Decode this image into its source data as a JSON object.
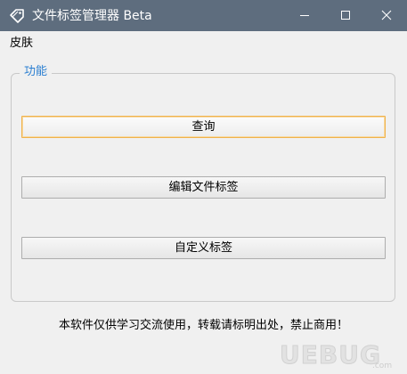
{
  "window": {
    "title": "文件标签管理器 Beta",
    "titlebar_color": "#5e6d7e"
  },
  "menu": {
    "items": [
      {
        "label": "皮肤"
      }
    ]
  },
  "group": {
    "legend": "功能",
    "legend_color": "#2b7fd1"
  },
  "buttons": {
    "query": "查询",
    "edit_file_tags": "编辑文件标签",
    "custom_tags": "自定义标签"
  },
  "footer": {
    "notice": "本软件仅供学习交流使用，转载请标明出处，禁止商用！"
  },
  "watermark": {
    "logo_text": "UEBUG",
    "sub_text": ".com"
  }
}
